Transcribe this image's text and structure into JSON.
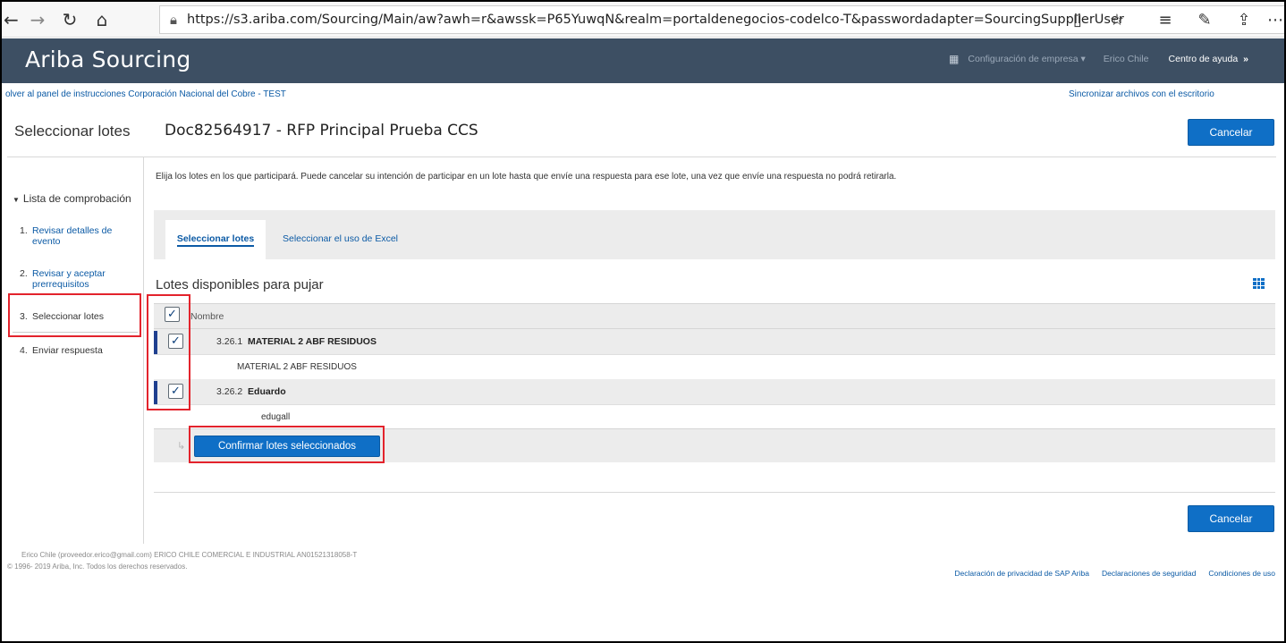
{
  "browser": {
    "url": "https://s3.ariba.com/Sourcing/Main/aw?awh=r&awssk=P65YuwqN&realm=portaldenegocios-codelco-T&passwordadapter=SourcingSupplierUser",
    "icons": [
      "back-icon",
      "forward-icon",
      "refresh-icon",
      "home-icon",
      "lock-icon",
      "reading-view-icon",
      "favorite-star-icon",
      "favorites-list-icon",
      "pen-icon",
      "share-icon",
      "more-icon"
    ]
  },
  "header": {
    "brand": "Ariba Sourcing",
    "company_config": "Configuración de empresa ▾",
    "user": "Erico Chile",
    "help": "Centro de ayuda",
    "help_arrow": "»"
  },
  "links": {
    "back": "olver al panel de instrucciones Corporación Nacional del Cobre - TEST",
    "sync": "Sincronizar archivos con el escritorio"
  },
  "page": {
    "left_title": "Seleccionar lotes",
    "doc_title": "Doc82564917 - RFP Principal Prueba CCS",
    "cancel": "Cancelar",
    "instructions": "Elija los lotes en los que participará. Puede cancelar su intención de participar en un lote hasta que envíe una respuesta para ese lote, una vez que envíe una respuesta no podrá retirarla."
  },
  "sidebar": {
    "heading": "Lista de comprobación",
    "steps": [
      {
        "num": "1.",
        "label": "Revisar detalles de evento"
      },
      {
        "num": "2.",
        "label": "Revisar y aceptar prerrequisitos"
      },
      {
        "num": "3.",
        "label": "Seleccionar lotes"
      },
      {
        "num": "4.",
        "label": "Enviar respuesta"
      }
    ]
  },
  "tabs": [
    {
      "label": "Seleccionar lotes",
      "active": true
    },
    {
      "label": "Seleccionar el uso de Excel",
      "active": false
    }
  ],
  "lots": {
    "title": "Lotes disponibles para pujar",
    "column_header": "Nombre",
    "check_mark": "✓",
    "rows": [
      {
        "number": "3.26.1",
        "name": "MATERIAL 2 ABF RESIDUOS",
        "description": "MATERIAL 2 ABF RESIDUOS",
        "checked": true
      },
      {
        "number": "3.26.2",
        "name": "Eduardo",
        "description": "edugall",
        "checked": true
      }
    ],
    "indent_arrow": "↳",
    "confirm_button": "Confirmar lotes seleccionados"
  },
  "footer": {
    "user_info": "Erico Chile (proveedor.erico@gmail.com)   ERICO CHILE COMERCIAL E INDUSTRIAL  AN01521318058-T",
    "copyright": "© 1996- 2019 Ariba, Inc. Todos los derechos reservados.",
    "links": [
      "Declaración de privacidad de SAP Ariba",
      "Declaraciones de seguridad",
      "Condiciones de uso"
    ]
  },
  "colors": {
    "header_bg": "#3d4f63",
    "primary_button": "#0f6fc6",
    "link": "#0b5aa5",
    "highlight_box": "#e3232c"
  }
}
